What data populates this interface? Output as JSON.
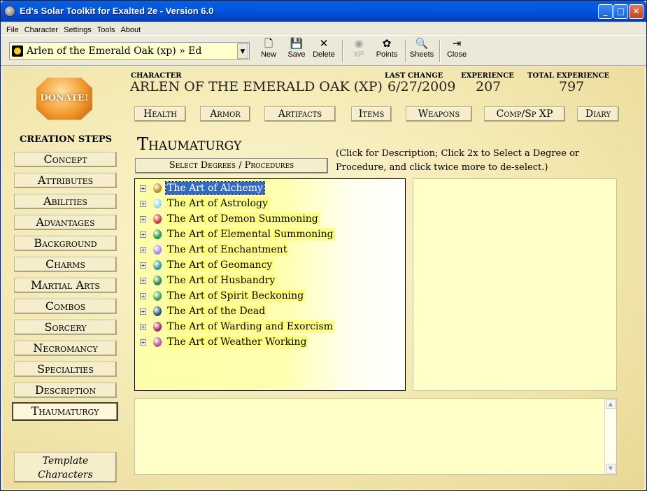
{
  "window": {
    "title": "Ed's Solar Toolkit for Exalted 2e - Version 6.0",
    "minimize_glyph": "_",
    "maximize_glyph": "□",
    "close_glyph": "✕"
  },
  "menu": [
    "File",
    "Character",
    "Settings",
    "Tools",
    "About"
  ],
  "toolbar": {
    "character_select": "Arlen of the Emerald Oak (xp) » Ed",
    "dropdown_glyph": "▼",
    "buttons": [
      {
        "label": "New",
        "glyph": "🗋"
      },
      {
        "label": "Save",
        "glyph": "💾"
      },
      {
        "label": "Delete",
        "glyph": "✕"
      },
      {
        "label": "XP",
        "glyph": "◉"
      },
      {
        "label": "Points",
        "glyph": "✿"
      },
      {
        "label": "Sheets",
        "glyph": "🔍"
      },
      {
        "label": "Close",
        "glyph": "⇥"
      }
    ]
  },
  "donate_label": "DONATE!",
  "header": {
    "character_label": "CHARACTER",
    "character_value": "ARLEN OF THE EMERALD OAK (XP)",
    "last_change_label": "LAST CHANGE",
    "last_change_value": "6/27/2009",
    "experience_label": "EXPERIENCE",
    "experience_value": "207",
    "total_experience_label": "TOTAL EXPERIENCE",
    "total_experience_value": "797"
  },
  "nav": [
    "Health",
    "Armor",
    "Artifacts",
    "Items",
    "Weapons",
    "Comp/Sp XP",
    "Diary"
  ],
  "creation": {
    "heading": "CREATION STEPS",
    "steps": [
      "Concept",
      "Attributes",
      "Abilities",
      "Advantages",
      "Background",
      "Charms",
      "Martial Arts",
      "Combos",
      "Sorcery",
      "Necromancy",
      "Specialties",
      "Description",
      "Thaumaturgy"
    ],
    "active_index": 12,
    "template_line1": "Template",
    "template_line2": "Characters"
  },
  "section": {
    "title": "Thaumaturgy",
    "select_button": "Select Degrees / Procedures",
    "instructions": "(Click for Description;  Click 2x to Select a Degree or Procedure, and click twice more to de-select.)"
  },
  "tree": {
    "expander_glyph": "+",
    "items": [
      {
        "label": "The Art of Alchemy",
        "gem": "#c08a20",
        "selected": true
      },
      {
        "label": "The Art of Astrology",
        "gem": "#9cd6f2"
      },
      {
        "label": "The Art of Demon Summoning",
        "gem": "#d8342a"
      },
      {
        "label": "The Art of Elemental Summoning",
        "gem": "#1a9a3a"
      },
      {
        "label": "The Art of Enchantment",
        "gem": "#a68ae0"
      },
      {
        "label": "The Art of Geomancy",
        "gem": "#2a9a8a"
      },
      {
        "label": "The Art of Husbandry",
        "gem": "#1f8a3f"
      },
      {
        "label": "The Art of Spirit Beckoning",
        "gem": "#3aa24a"
      },
      {
        "label": "The Art of the Dead",
        "gem": "#1d5a6a"
      },
      {
        "label": "The Art of Warding and Exorcism",
        "gem": "#b02a5a"
      },
      {
        "label": "The Art of Weather Working",
        "gem": "#c0508a"
      }
    ]
  },
  "description_scroll": {
    "up": "▲",
    "down": "▼"
  }
}
